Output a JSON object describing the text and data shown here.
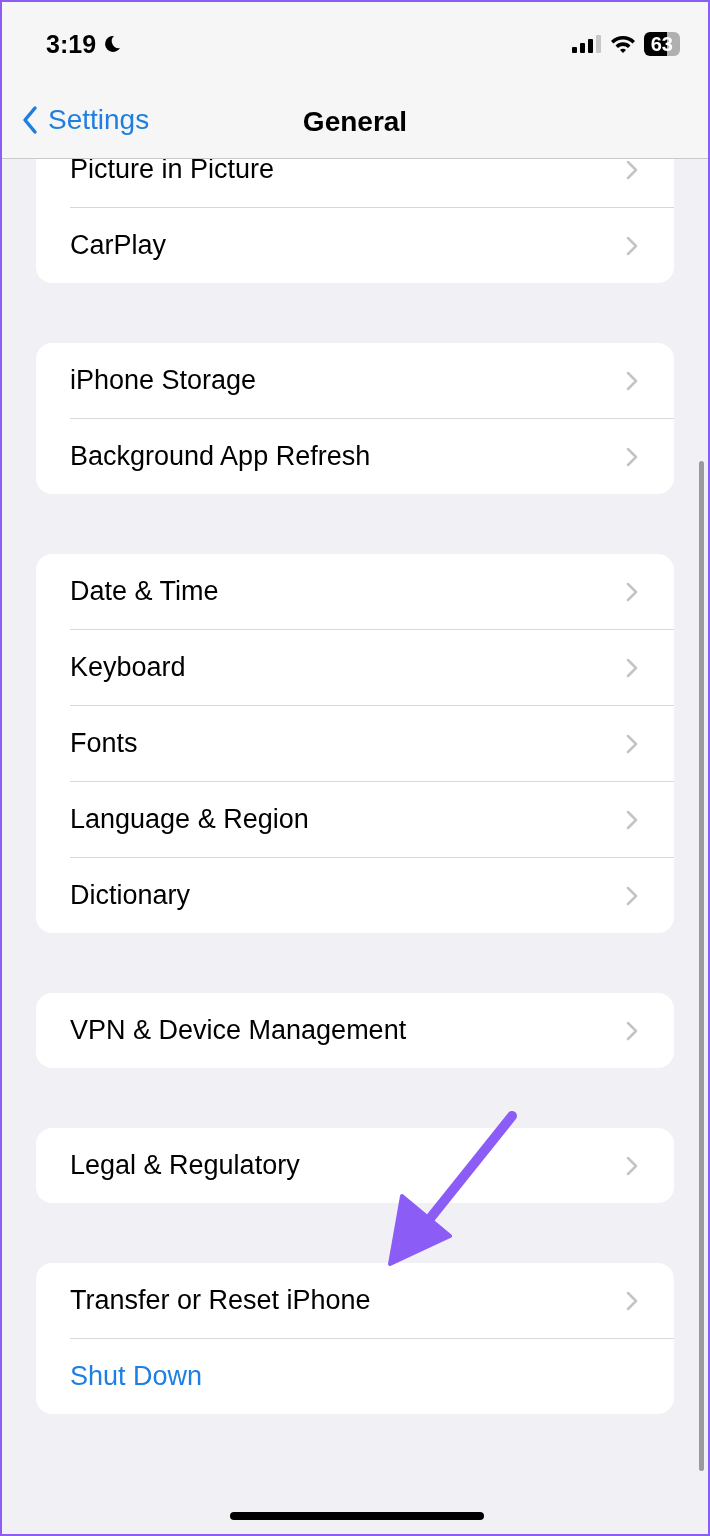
{
  "status_bar": {
    "time": "3:19",
    "battery": "63"
  },
  "nav_bar": {
    "back": "Settings",
    "title": "General"
  },
  "groups": [
    {
      "items": [
        {
          "label": "Picture in Picture",
          "kind": "link"
        },
        {
          "label": "CarPlay",
          "kind": "link"
        }
      ]
    },
    {
      "items": [
        {
          "label": "iPhone Storage",
          "kind": "link"
        },
        {
          "label": "Background App Refresh",
          "kind": "link"
        }
      ]
    },
    {
      "items": [
        {
          "label": "Date & Time",
          "kind": "link"
        },
        {
          "label": "Keyboard",
          "kind": "link"
        },
        {
          "label": "Fonts",
          "kind": "link"
        },
        {
          "label": "Language & Region",
          "kind": "link"
        },
        {
          "label": "Dictionary",
          "kind": "link"
        }
      ]
    },
    {
      "items": [
        {
          "label": "VPN & Device Management",
          "kind": "link"
        }
      ]
    },
    {
      "items": [
        {
          "label": "Legal & Regulatory",
          "kind": "link"
        }
      ]
    },
    {
      "items": [
        {
          "label": "Transfer or Reset iPhone",
          "kind": "link"
        },
        {
          "label": "Shut Down",
          "kind": "action"
        }
      ]
    }
  ]
}
